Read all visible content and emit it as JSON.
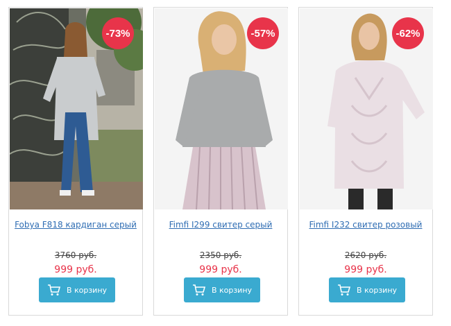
{
  "products": [
    {
      "badge": "-73%",
      "name": "Fobya F818 кардиган серый",
      "old_price": "3760 руб.",
      "new_price": "999 руб.",
      "button_label": "В корзину",
      "image_desc": "woman in long grey cardigan and flared jeans"
    },
    {
      "badge": "-57%",
      "name": "Fimfi I299 свитер серый",
      "old_price": "2350 руб.",
      "new_price": "999 руб.",
      "button_label": "В корзину",
      "image_desc": "woman in grey sweater and pleated pink skirt"
    },
    {
      "badge": "-62%",
      "name": "Fimfi I232 свитер розовый",
      "old_price": "2620 руб.",
      "new_price": "999 руб.",
      "button_label": "В корзину",
      "image_desc": "woman in pink cable-knit sweater dress"
    }
  ],
  "colors": {
    "badge": "#e8344a",
    "price": "#e8344a",
    "link": "#2f6db3",
    "button": "#3aaad0"
  },
  "icons": {
    "cart": "cart-icon"
  }
}
